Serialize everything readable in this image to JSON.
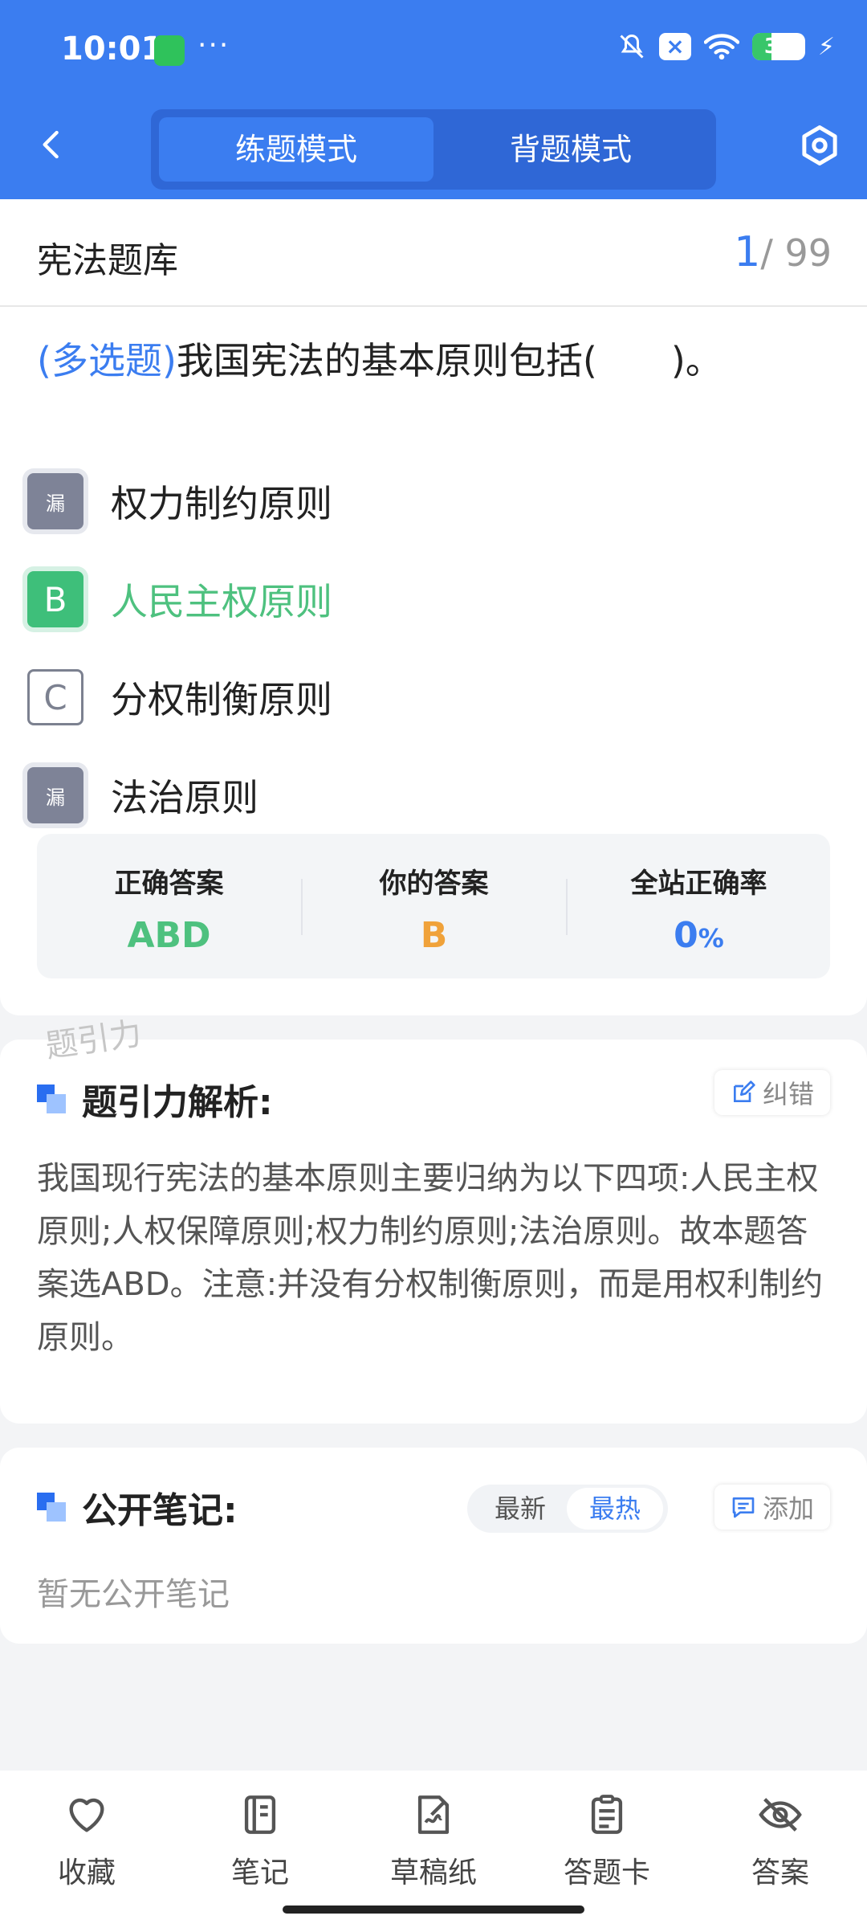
{
  "status_bar": {
    "time": "10:01",
    "more": "···",
    "battery": "36"
  },
  "nav": {
    "tab_practice": "练题模式",
    "tab_review": "背题模式"
  },
  "header": {
    "bank_title": "宪法题库",
    "current": "1",
    "total": "/ 99"
  },
  "question": {
    "type": "(多选题)",
    "text": "我国宪法的基本原则包括(　　)。"
  },
  "options": [
    {
      "badge": "漏",
      "text": "权力制约原则",
      "state": "missed"
    },
    {
      "badge": "B",
      "text": "人民主权原则",
      "state": "selected-correct"
    },
    {
      "badge": "C",
      "text": "分权制衡原则",
      "state": "normal"
    },
    {
      "badge": "漏",
      "text": "法治原则",
      "state": "missed"
    }
  ],
  "answers": {
    "correct_label": "正确答案",
    "correct_value": "ABD",
    "yours_label": "你的答案",
    "yours_value": "B",
    "rate_label": "全站正确率",
    "rate_value": "0",
    "rate_unit": "%"
  },
  "analysis": {
    "watermark": "题引力",
    "title": "题引力解析:",
    "report_label": "纠错",
    "text": "我国现行宪法的基本原则主要归纳为以下四项:人民主权原则;人权保障原则;权力制约原则;法治原则。故本题答案选ABD。注意:并没有分权制衡原则，而是用权利制约原则。"
  },
  "notes": {
    "title": "公开笔记:",
    "sort_latest": "最新",
    "sort_hot": "最热",
    "add_label": "添加",
    "empty": "暂无公开笔记"
  },
  "bottom_bar": {
    "items": [
      "收藏",
      "笔记",
      "草稿纸",
      "答题卡",
      "答案"
    ]
  },
  "colors": {
    "primary": "#3b7df0",
    "correct": "#4ec17f",
    "wrong": "#f0a23a"
  }
}
